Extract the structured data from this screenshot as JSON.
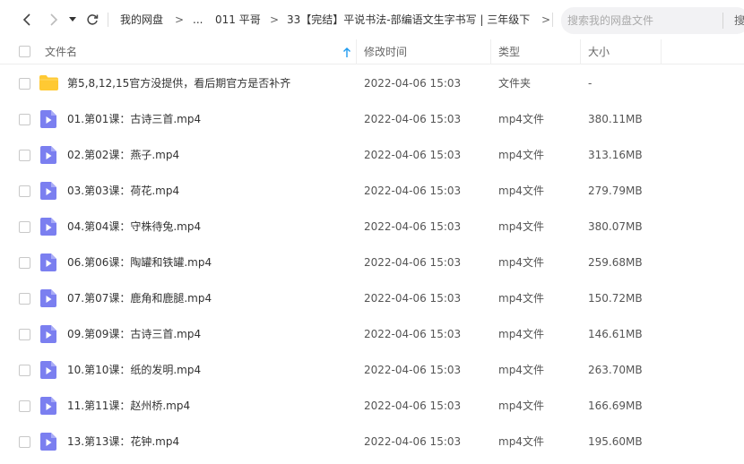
{
  "nav": {
    "back_icon": "chevron-left-icon",
    "forward_icon": "chevron-right-icon",
    "history_icon": "caret-down-icon",
    "refresh_icon": "refresh-icon"
  },
  "breadcrumb": {
    "items": [
      "我的网盘",
      "...",
      "011 平哥",
      "33【完结】平说书法-部编语文生字书写 | 三年级下"
    ],
    "separator": ">"
  },
  "search": {
    "placeholder": "搜索我的网盘文件",
    "filter_label": "搜"
  },
  "columns": {
    "name": "文件名",
    "modified": "修改时间",
    "type": "类型",
    "size": "大小"
  },
  "colors": {
    "folder": "#ffc933",
    "video_icon": "#7b7ff0",
    "sort_arrow": "#1e9bf0"
  },
  "files": [
    {
      "name": "第5,8,12,15官方没提供，看后期官方是否补齐",
      "modified": "2022-04-06 15:03",
      "type": "文件夹",
      "size": "-",
      "icon": "folder-icon"
    },
    {
      "name": "01.第01课：古诗三首.mp4",
      "modified": "2022-04-06 15:03",
      "type": "mp4文件",
      "size": "380.11MB",
      "icon": "video-file-icon"
    },
    {
      "name": "02.第02课：燕子.mp4",
      "modified": "2022-04-06 15:03",
      "type": "mp4文件",
      "size": "313.16MB",
      "icon": "video-file-icon"
    },
    {
      "name": "03.第03课：荷花.mp4",
      "modified": "2022-04-06 15:03",
      "type": "mp4文件",
      "size": "279.79MB",
      "icon": "video-file-icon"
    },
    {
      "name": "04.第04课：守株待兔.mp4",
      "modified": "2022-04-06 15:03",
      "type": "mp4文件",
      "size": "380.07MB",
      "icon": "video-file-icon"
    },
    {
      "name": "06.第06课：陶罐和铁罐.mp4",
      "modified": "2022-04-06 15:03",
      "type": "mp4文件",
      "size": "259.68MB",
      "icon": "video-file-icon"
    },
    {
      "name": "07.第07课：鹿角和鹿腿.mp4",
      "modified": "2022-04-06 15:03",
      "type": "mp4文件",
      "size": "150.72MB",
      "icon": "video-file-icon"
    },
    {
      "name": "09.第09课：古诗三首.mp4",
      "modified": "2022-04-06 15:03",
      "type": "mp4文件",
      "size": "146.61MB",
      "icon": "video-file-icon"
    },
    {
      "name": "10.第10课：纸的发明.mp4",
      "modified": "2022-04-06 15:03",
      "type": "mp4文件",
      "size": "263.70MB",
      "icon": "video-file-icon"
    },
    {
      "name": "11.第11课：赵州桥.mp4",
      "modified": "2022-04-06 15:03",
      "type": "mp4文件",
      "size": "166.69MB",
      "icon": "video-file-icon"
    },
    {
      "name": "13.第13课：花钟.mp4",
      "modified": "2022-04-06 15:03",
      "type": "mp4文件",
      "size": "195.60MB",
      "icon": "video-file-icon"
    }
  ]
}
